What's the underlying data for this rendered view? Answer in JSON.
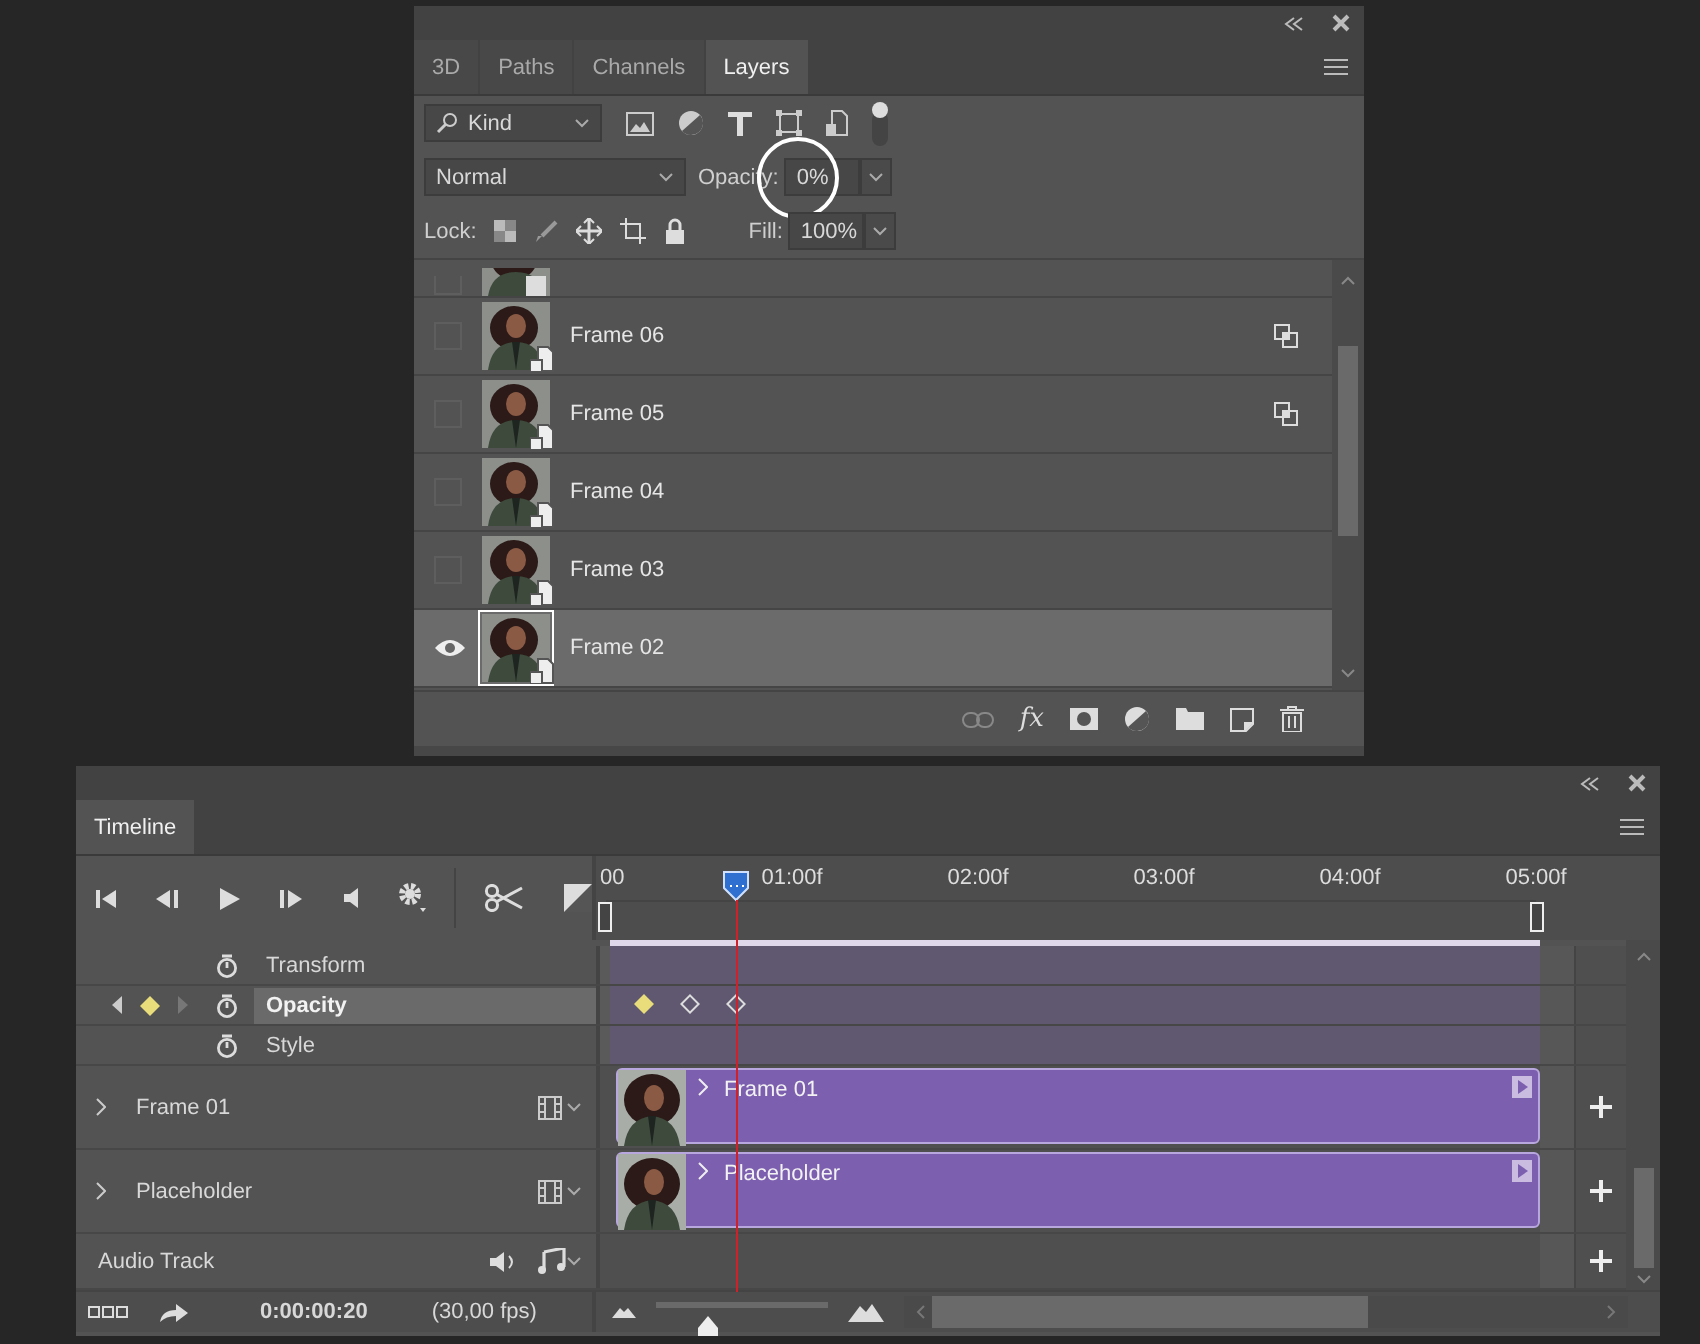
{
  "layers_panel": {
    "tabs": [
      {
        "label": "3D",
        "selected": false
      },
      {
        "label": "Paths",
        "selected": false
      },
      {
        "label": "Channels",
        "selected": false
      },
      {
        "label": "Layers",
        "selected": true
      }
    ],
    "filter": {
      "value": "Kind"
    },
    "blend_mode": {
      "value": "Normal"
    },
    "opacity": {
      "label": "Opacity:",
      "value": "0%",
      "circled": true
    },
    "lock": {
      "label": "Lock:"
    },
    "fill": {
      "label": "Fill:",
      "value": "100%"
    },
    "layers": [
      {
        "name": "Frame 06",
        "visible": false,
        "selected": false,
        "linked": true
      },
      {
        "name": "Frame 05",
        "visible": false,
        "selected": false,
        "linked": true
      },
      {
        "name": "Frame 04",
        "visible": false,
        "selected": false,
        "linked": false
      },
      {
        "name": "Frame 03",
        "visible": false,
        "selected": false,
        "linked": false
      },
      {
        "name": "Frame 02",
        "visible": true,
        "selected": true,
        "linked": false
      }
    ],
    "effects_button": "fx"
  },
  "timeline": {
    "tab": {
      "label": "Timeline",
      "selected": true
    },
    "ruler": [
      "00",
      "01:00f",
      "02:00f",
      "03:00f",
      "04:00f",
      "05:00f"
    ],
    "playhead": {
      "level": 0.135
    },
    "tracks": [
      {
        "kind": "property",
        "name": "Transform",
        "selected": false
      },
      {
        "kind": "property",
        "name": "Opacity",
        "selected": true,
        "keyframes": [
          {
            "selected": true
          },
          {
            "selected": false
          },
          {
            "selected": false
          }
        ]
      },
      {
        "kind": "property",
        "name": "Style",
        "selected": false
      },
      {
        "kind": "layer",
        "name": "Frame 01",
        "clip": "Frame 01"
      },
      {
        "kind": "layer",
        "name": "Placeholder",
        "clip": "Placeholder"
      },
      {
        "kind": "audio",
        "name": "Audio Track"
      }
    ],
    "current_time": "0:00:00:20",
    "frame_rate": "(30,00 fps)",
    "zoom": {
      "level": 0.3
    }
  }
}
